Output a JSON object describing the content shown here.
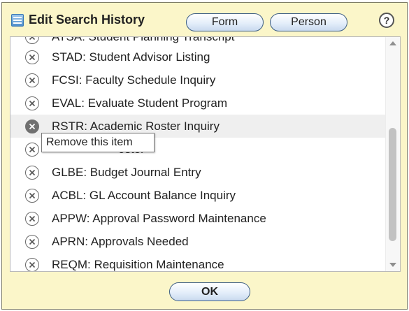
{
  "dialog": {
    "title": "Edit Search History",
    "form_button": "Form",
    "person_button": "Person",
    "help_button": "?",
    "ok_button": "OK"
  },
  "list": {
    "items": [
      {
        "label": "ATSA: Student Planning Transcript"
      },
      {
        "label": "STAD: Student Advisor Listing"
      },
      {
        "label": "FCSI: Faculty Schedule Inquiry"
      },
      {
        "label": "EVAL: Evaluate Student Program"
      },
      {
        "label": "RSTR: Academic Roster Inquiry"
      },
      {
        "label": "oster"
      },
      {
        "label": "GLBE: Budget Journal Entry"
      },
      {
        "label": "ACBL: GL Account Balance Inquiry"
      },
      {
        "label": "APPW: Approval Password Maintenance"
      },
      {
        "label": "APRN: Approvals Needed"
      },
      {
        "label": "REQM: Requisition Maintenance"
      }
    ],
    "hovered_index": 4
  },
  "tooltip": {
    "text": "Remove this item"
  },
  "icons": {
    "remove": "circle-x-icon",
    "app": "list-icon",
    "help": "question-icon"
  },
  "colors": {
    "dialog_bg": "#fbf6c9",
    "button_border": "#3d5e84",
    "hover_row": "#efefef"
  }
}
